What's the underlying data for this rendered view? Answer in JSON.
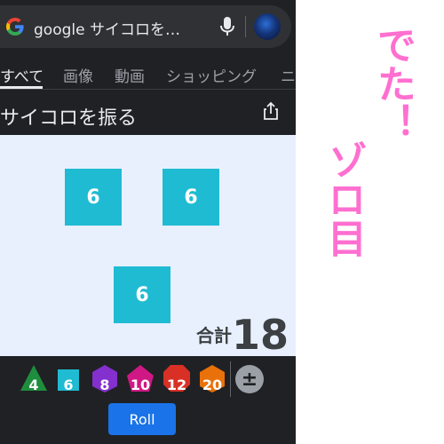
{
  "search": {
    "query": "google サイコロを…"
  },
  "tabs": [
    {
      "label": "すべて",
      "active": true
    },
    {
      "label": "画像"
    },
    {
      "label": "動画"
    },
    {
      "label": "ショッピング"
    },
    {
      "label": "ニ"
    }
  ],
  "card": {
    "title": "サイコロを振る"
  },
  "dice": [
    {
      "value": "6"
    },
    {
      "value": "6"
    },
    {
      "value": "6"
    }
  ],
  "total": {
    "label": "合計",
    "value": "18"
  },
  "dice_types": [
    {
      "label": "4",
      "color": "#1e8e3e"
    },
    {
      "label": "6",
      "color": "#1fbbd2"
    },
    {
      "label": "8",
      "color": "#8430ce"
    },
    {
      "label": "10",
      "color": "#d01884"
    },
    {
      "label": "12",
      "color": "#d93025"
    },
    {
      "label": "20",
      "color": "#e8710a"
    }
  ],
  "adjust": {
    "label": "±"
  },
  "roll_button": {
    "label": "Roll"
  },
  "caption": {
    "line1": "でた！",
    "line2": "ゾロ目"
  }
}
